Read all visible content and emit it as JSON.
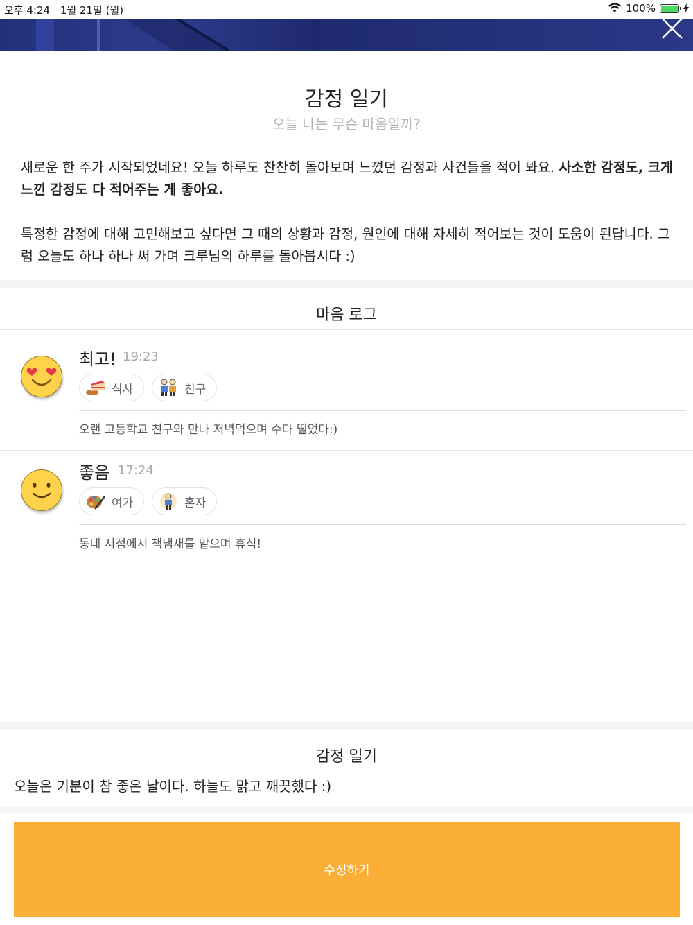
{
  "status_bar": {
    "time": "오후 4:24",
    "date": "1월 21일 (월)",
    "battery": "100%",
    "battery_level": 1.0
  },
  "header": {
    "title": "감정 일기",
    "subtitle": "오늘 나는 무슨 마음일까?"
  },
  "intro": {
    "p1_normal": "새로운 한 주가 시작되었네요! 오늘 하루도 찬찬히 돌아보며 느꼈던 감정과 사건들을 적어 봐요. ",
    "p1_bold": "사소한 감정도, 크게 느낀 감정도 다 적어주는 게 좋아요.",
    "p2": "특정한 감정에 대해 고민해보고 싶다면 그 때의 상황과 감정, 원인에 대해 자세히 적어보는 것이 도움이 된답니다. 그럼 오늘도 하나 하나 써 가며 크루님의 하루를 돌아봅시다 :)"
  },
  "mood_log": {
    "title": "마음 로그",
    "entries": [
      {
        "mood": "최고!",
        "time": "19:23",
        "face_icon": "heart-eyes-face-icon",
        "tags": [
          {
            "label": "식사",
            "icon": "cake-bread-icon"
          },
          {
            "label": "친구",
            "icon": "friends-icon"
          }
        ],
        "note": "오랜 고등학교 친구와 만나 저녁먹으며 수다 떨었다:)"
      },
      {
        "mood": "좋음",
        "time": "17:24",
        "face_icon": "smile-face-icon",
        "tags": [
          {
            "label": "여가",
            "icon": "palette-icon"
          },
          {
            "label": "혼자",
            "icon": "person-icon"
          }
        ],
        "note": "동네 서점에서 책냄새를 맡으며 휴식!"
      }
    ]
  },
  "diary": {
    "title": "감정 일기",
    "text": "오늘은 기분이 참 좋은 날이다. 하늘도 맑고 깨끗했다 :)"
  },
  "edit_button": {
    "label": "수정하기"
  },
  "colors": {
    "accent": "#fbae35",
    "header_bg": "#23307a",
    "face": "#ffd24c",
    "subtitle": "#b3b3b3"
  }
}
